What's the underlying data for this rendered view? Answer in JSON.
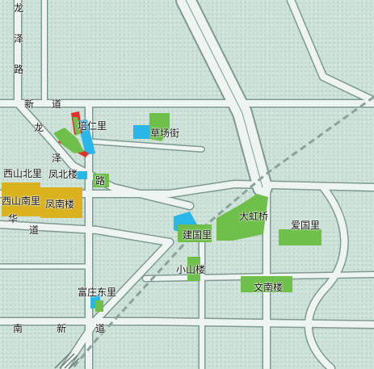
{
  "colors": {
    "background": "#cde2d8",
    "road": "#eef4f1",
    "road_edge": "#7f9a92",
    "green_area": "#6fc04a",
    "blue_area": "#29b6e8",
    "yellow_area": "#d9b21e",
    "red_area": "#e0302a",
    "railway": "#8aa39c"
  },
  "roads": {
    "long_ze_road": [
      "龙",
      "泽",
      "路"
    ],
    "long_ze_road_diag": [
      "龙",
      "泽",
      "路"
    ],
    "top_road": [
      "新",
      "道"
    ],
    "hua_road": [
      "华",
      "道"
    ],
    "nan_xin_road": [
      "南",
      "新",
      "道"
    ]
  },
  "areas": {
    "peiren_li": "培仁里",
    "caochang_jie": "草场街",
    "xishan_bei_li": "西山北里",
    "fengbei_lou": "凤北楼",
    "xishan_nan_li": "西山南里",
    "fengnan_lou": "凤南楼",
    "dahong_qiao": "大虹桥",
    "aiguo_li": "爱国里",
    "jianguo_li": "建国里",
    "xiaoshan_lou": "小山楼",
    "wennan_lou": "文南楼",
    "fuzhuang_dong_li": "富庄东里"
  }
}
